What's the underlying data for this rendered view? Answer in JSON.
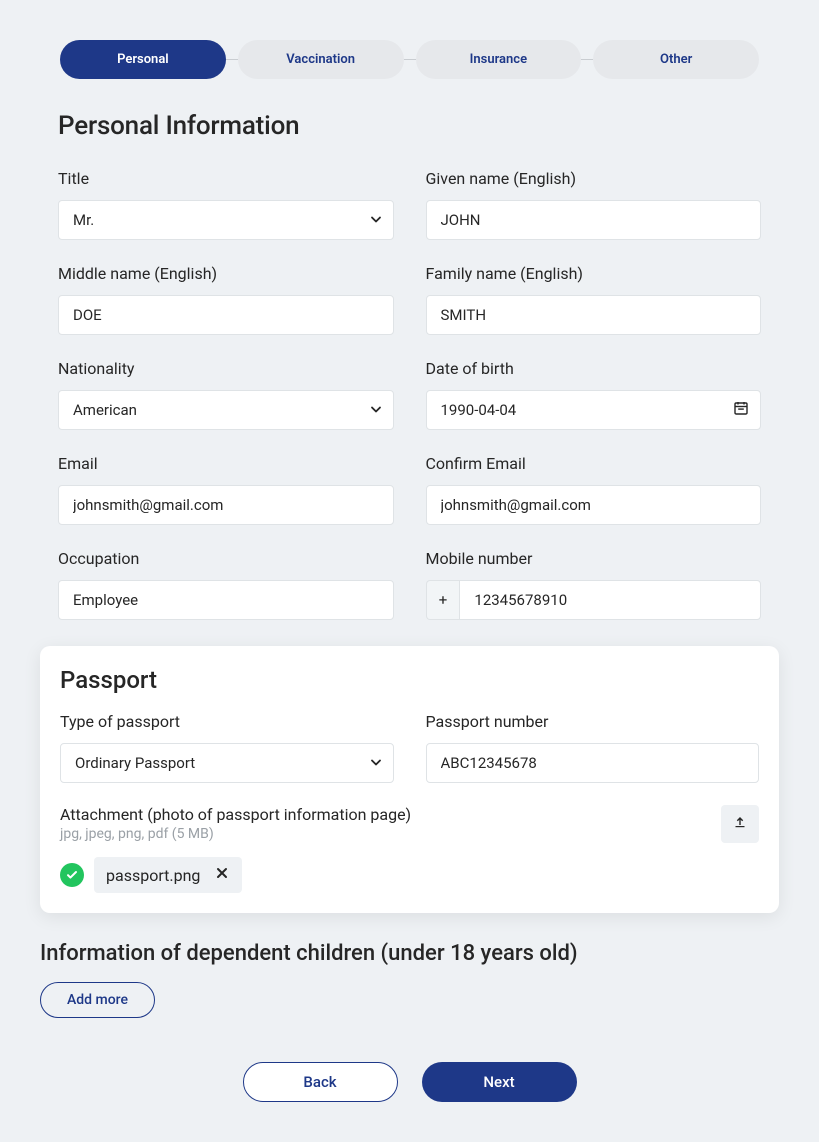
{
  "stepper": {
    "items": [
      {
        "label": "Personal",
        "active": true
      },
      {
        "label": "Vaccination",
        "active": false
      },
      {
        "label": "Insurance",
        "active": false
      },
      {
        "label": "Other",
        "active": false
      }
    ]
  },
  "section_title": "Personal Information",
  "fields": {
    "title": {
      "label": "Title",
      "value": "Mr."
    },
    "given_name": {
      "label": "Given name (English)",
      "value": "JOHN"
    },
    "middle_name": {
      "label": "Middle name (English)",
      "value": "DOE"
    },
    "family_name": {
      "label": "Family name (English)",
      "value": "SMITH"
    },
    "nationality": {
      "label": "Nationality",
      "value": "American"
    },
    "dob": {
      "label": "Date of birth",
      "value": "1990-04-04"
    },
    "email": {
      "label": "Email",
      "value": "johnsmith@gmail.com"
    },
    "confirm_email": {
      "label": "Confirm Email",
      "value": "johnsmith@gmail.com"
    },
    "occupation": {
      "label": "Occupation",
      "value": "Employee"
    },
    "mobile": {
      "label": "Mobile number",
      "prefix": "+",
      "value": "12345678910"
    }
  },
  "passport": {
    "title": "Passport",
    "type": {
      "label": "Type of passport",
      "value": "Ordinary Passport"
    },
    "number": {
      "label": "Passport number",
      "value": "ABC12345678"
    },
    "attach": {
      "label": "Attachment (photo of passport information page)",
      "hint": "jpg, jpeg, png, pdf (5 MB)",
      "chip": "passport.png"
    }
  },
  "dependents": {
    "title": "Information of dependent children (under 18 years old)",
    "add_label": "Add more"
  },
  "nav": {
    "back": "Back",
    "next": "Next"
  }
}
